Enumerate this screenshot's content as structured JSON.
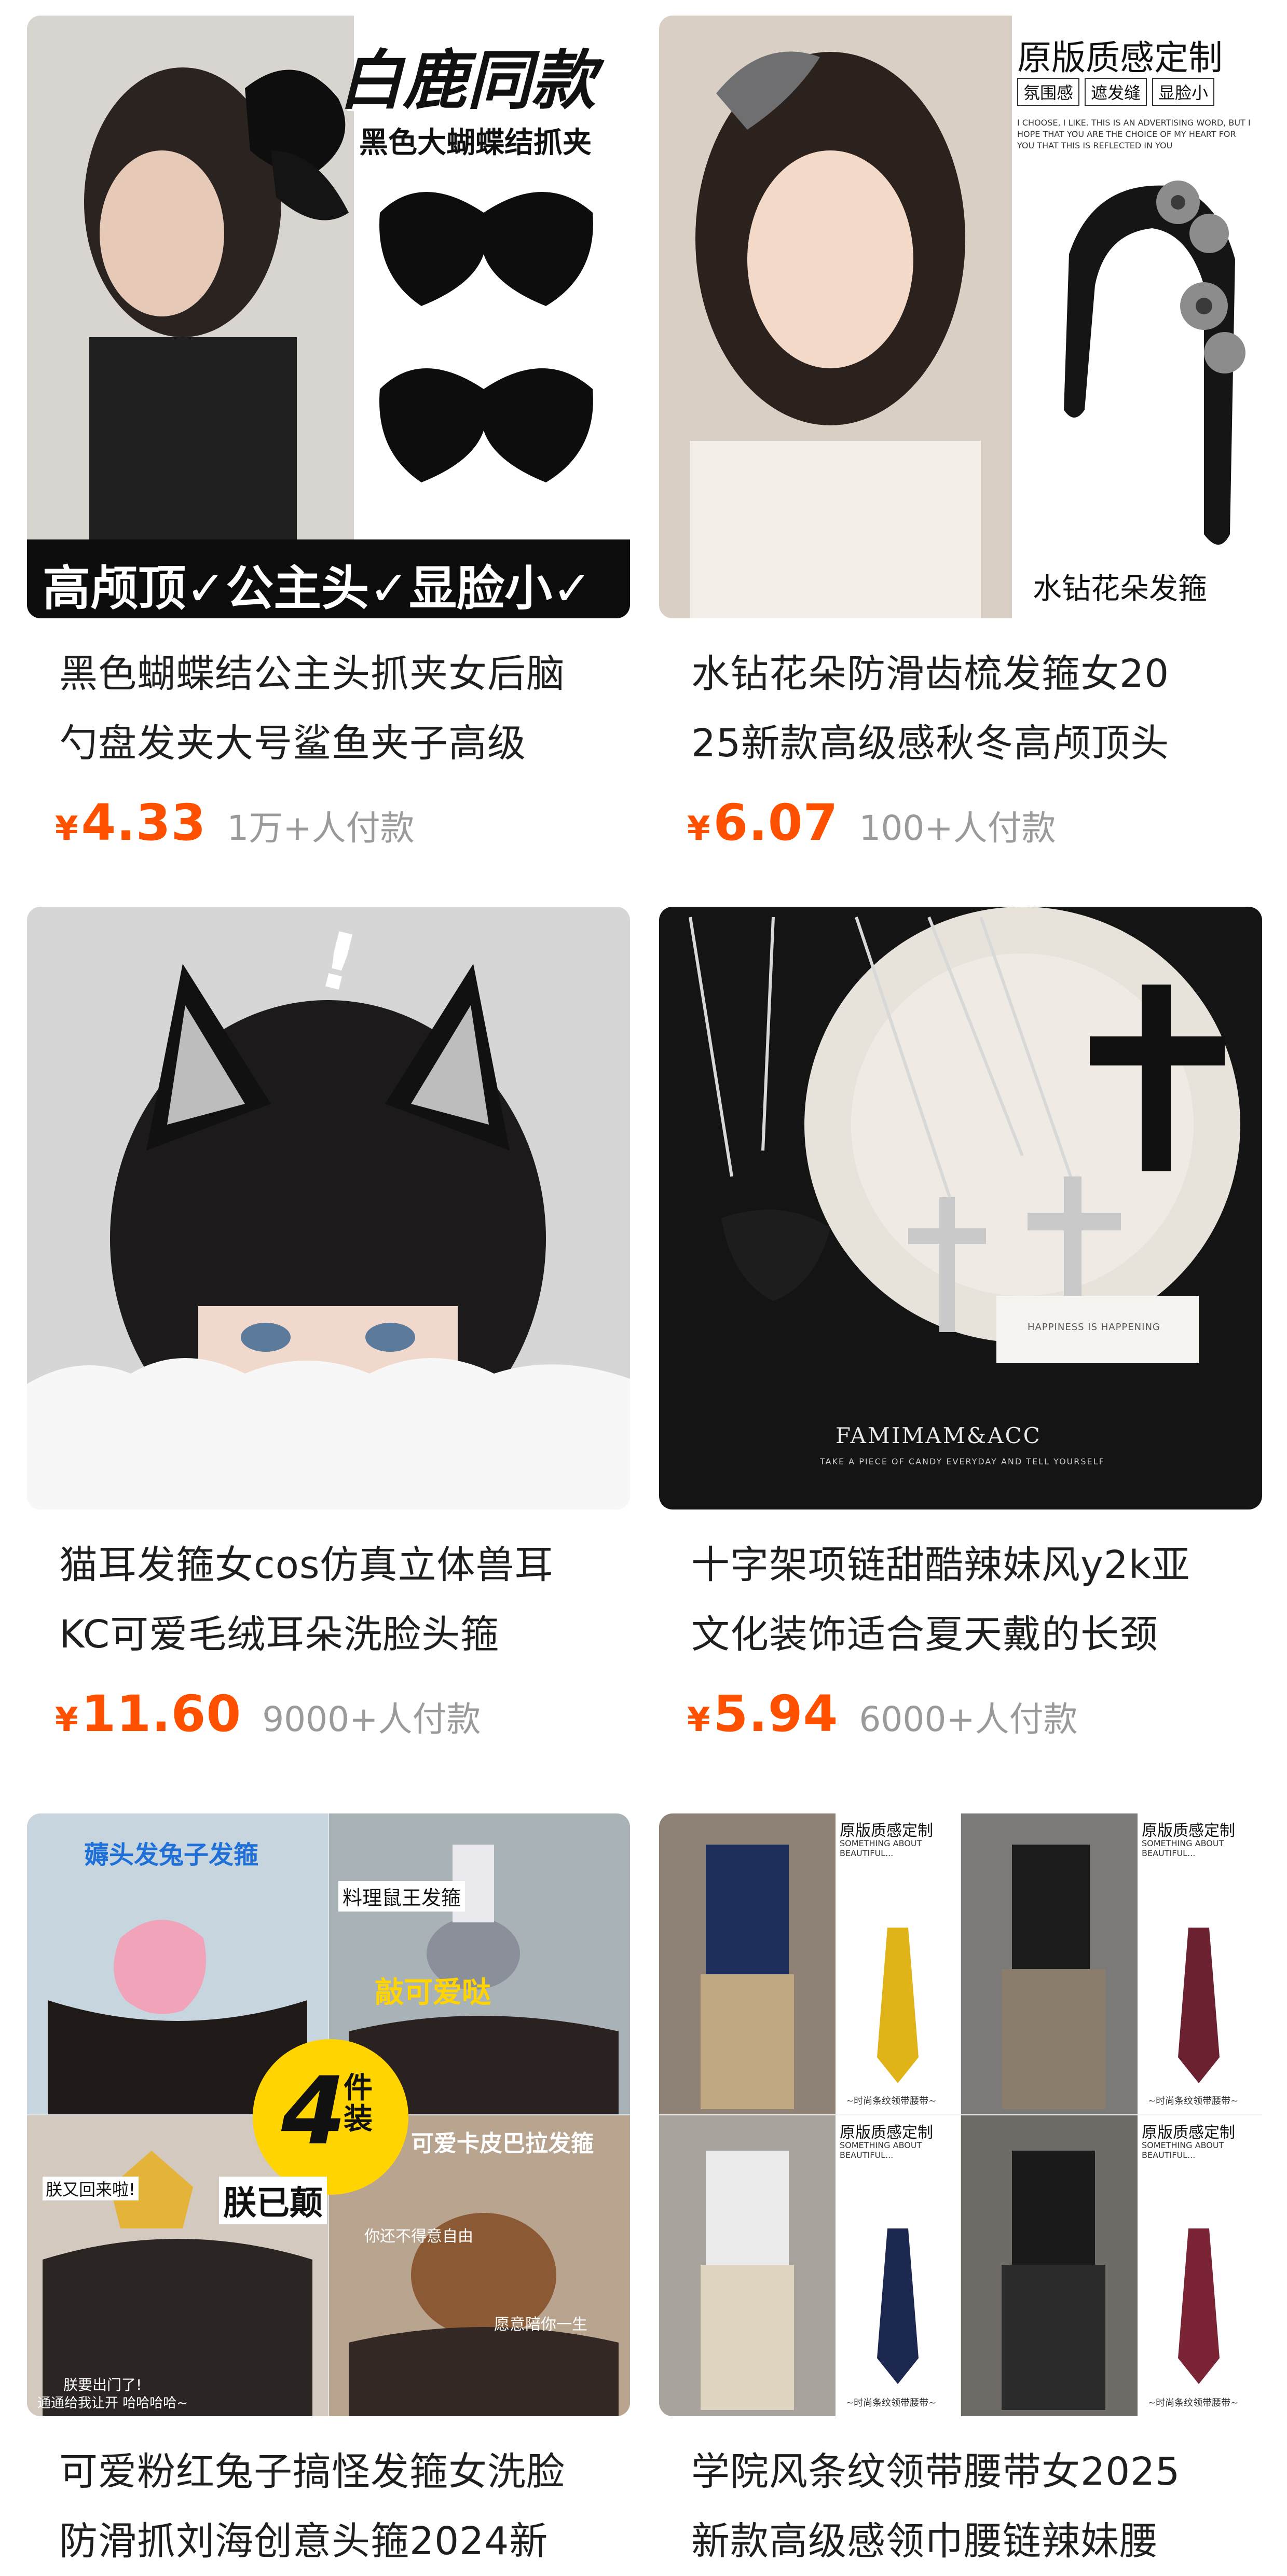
{
  "colors": {
    "price": "#ff5000",
    "title": "#1f1f1f",
    "sales": "#9a9a9a",
    "background": "#ffffff"
  },
  "products": [
    {
      "title_lines": [
        "黑色蝴蝶结公主头抓夹女后脑",
        "勺盘发夹大号鲨鱼夹子高级"
      ],
      "currency": "¥",
      "price": "4.33",
      "sales": "1万+人付款",
      "image": {
        "headline": "白鹿同款",
        "subline": "黑色大蝴蝶结抓夹",
        "banner": "高颅顶✓公主头✓显脸小✓"
      }
    },
    {
      "title_lines": [
        "水钻花朵防滑齿梳发箍女20",
        "25新款高级感秋冬高颅顶头"
      ],
      "currency": "¥",
      "price": "6.07",
      "sales": "100+人付款",
      "image": {
        "headline": "原版质感定制",
        "tags": [
          "氛围感",
          "遮发缝",
          "显脸小"
        ],
        "caption": "水钻花朵发箍",
        "fine_print": "I CHOOSE, I LIKE. THIS IS AN ADVERTISING WORD, BUT I HOPE THAT YOU ARE THE CHOICE OF MY HEART FOR YOU THAT THIS IS REFLECTED IN YOU"
      }
    },
    {
      "title_lines": [
        "猫耳发箍女cos仿真立体兽耳",
        "KC可爱毛绒耳朵洗脸头箍"
      ],
      "currency": "¥",
      "price": "11.60",
      "sales": "9000+人付款",
      "image": {
        "mark": "!"
      }
    },
    {
      "title_lines": [
        "十字架项链甜酷辣妹风y2k亚",
        "文化装饰适合夏天戴的长颈"
      ],
      "currency": "¥",
      "price": "5.94",
      "sales": "6000+人付款",
      "image": {
        "brand": "FAMIMAM&ACC",
        "tagline": "TAKE A PIECE OF CANDY EVERYDAY AND TELL YOURSELF",
        "card_text": "HAPPINESS IS HAPPENING"
      }
    },
    {
      "title_lines": [
        "可爱粉红兔子搞怪发箍女洗脸",
        "防滑抓刘海创意头箍2024新"
      ],
      "currency": "¥",
      "price": "",
      "sales": "",
      "image": {
        "top_label": "薅头发兔子发箍",
        "rat_label": "料理鼠王发箍",
        "rat_sub": "敲可爱哒",
        "count_num": "4",
        "count_unit": "件装",
        "capy_label": "可爱卡皮巴拉发箍",
        "capy_sub": "你还不得意自由",
        "capy_sub2": "愿意陪你一生",
        "crown_label": "朕已颠",
        "crown_sub": "朕又回来啦!",
        "bottom_left": "朕要出门了!",
        "bottom_left2": "通通给我让开 哈哈哈哈~"
      }
    },
    {
      "title_lines": [
        "学院风条纹领带腰带女2025",
        "新款高级感领巾腰链辣妹腰"
      ],
      "currency": "¥",
      "price": "",
      "sales": "",
      "image": {
        "panel_title": "原版质感定制",
        "panel_sub": "SOMETHING ABOUT BEAUTIFUL...",
        "panel_foot": "~时尚条纹领带腰带~"
      }
    }
  ]
}
